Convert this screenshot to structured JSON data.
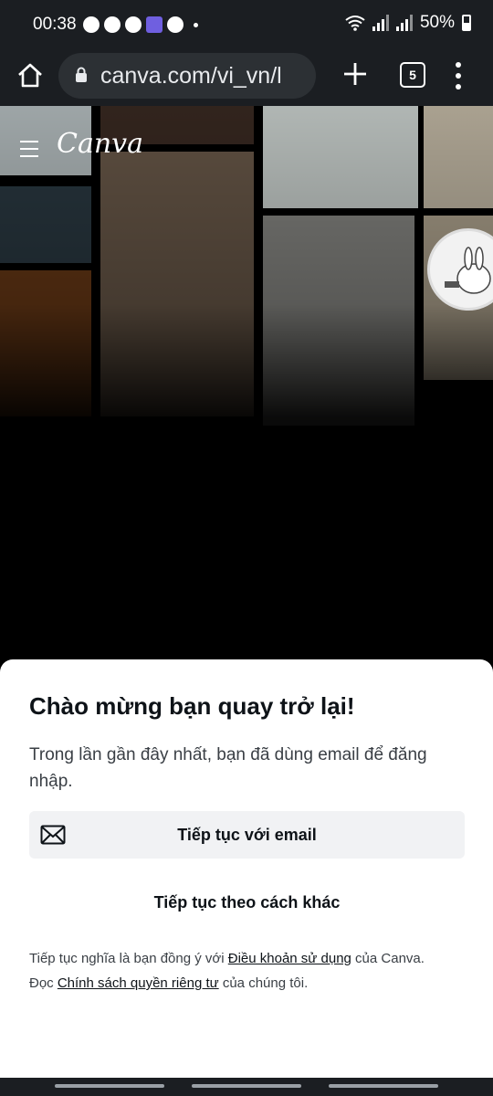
{
  "status_bar": {
    "time": "00:38",
    "battery": "50%",
    "notification_icons": [
      "chat-bubble-icon",
      "messenger-icon",
      "facebook-icon",
      "game-icon",
      "facebook-icon"
    ]
  },
  "browser": {
    "url": "canva.com/vi_vn/l",
    "tab_count": "5"
  },
  "header": {
    "logo": "Canva"
  },
  "sheet": {
    "title": "Chào mừng bạn quay trở lại!",
    "description": "Trong lần gần đây nhất, bạn đã dùng email để đăng nhập.",
    "email_button": "Tiếp tục với email",
    "other_button": "Tiếp tục theo cách khác",
    "legal_prefix": "Tiếp tục nghĩa là bạn đồng ý với ",
    "terms_link": "Điều khoản sử dụng",
    "legal_middle": " của Canva.",
    "legal_read": "Đọc ",
    "privacy_link": "Chính sách quyền riêng tư",
    "legal_suffix": " của chúng tôi."
  },
  "colors": {
    "sheet_bg": "#ffffff",
    "button_bg": "#f1f2f4",
    "browser_bar": "#1b1e22"
  }
}
